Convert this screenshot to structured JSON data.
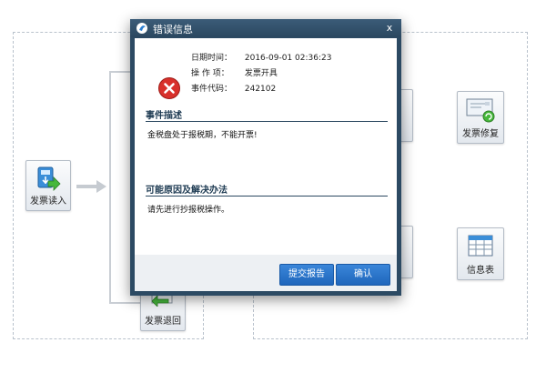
{
  "background": {
    "tiles": {
      "invoice_read": "发票读入",
      "invoice_return": "发票退回",
      "invoice_repair": "发票修复",
      "info_table": "信息表"
    }
  },
  "dialog": {
    "title": "错误信息",
    "close_glyph": "x",
    "date_label": "日期时间：",
    "date_value": "2016-09-01 02:36:23",
    "operation_label": "操  作  项：",
    "operation_value": "发票开具",
    "event_code_label": "事件代码：",
    "event_code_value": "242102",
    "description_heading": "事件描述",
    "description_text": "金税盘处于报税期，不能开票!",
    "solution_heading": "可能原因及解决办法",
    "solution_text": "请先进行抄报税操作。",
    "submit_button": "提交报告",
    "confirm_button": "确认"
  },
  "colors": {
    "dialog_frame": "#2c4a63",
    "button": "#2a73c9",
    "error_red": "#d8302b"
  }
}
